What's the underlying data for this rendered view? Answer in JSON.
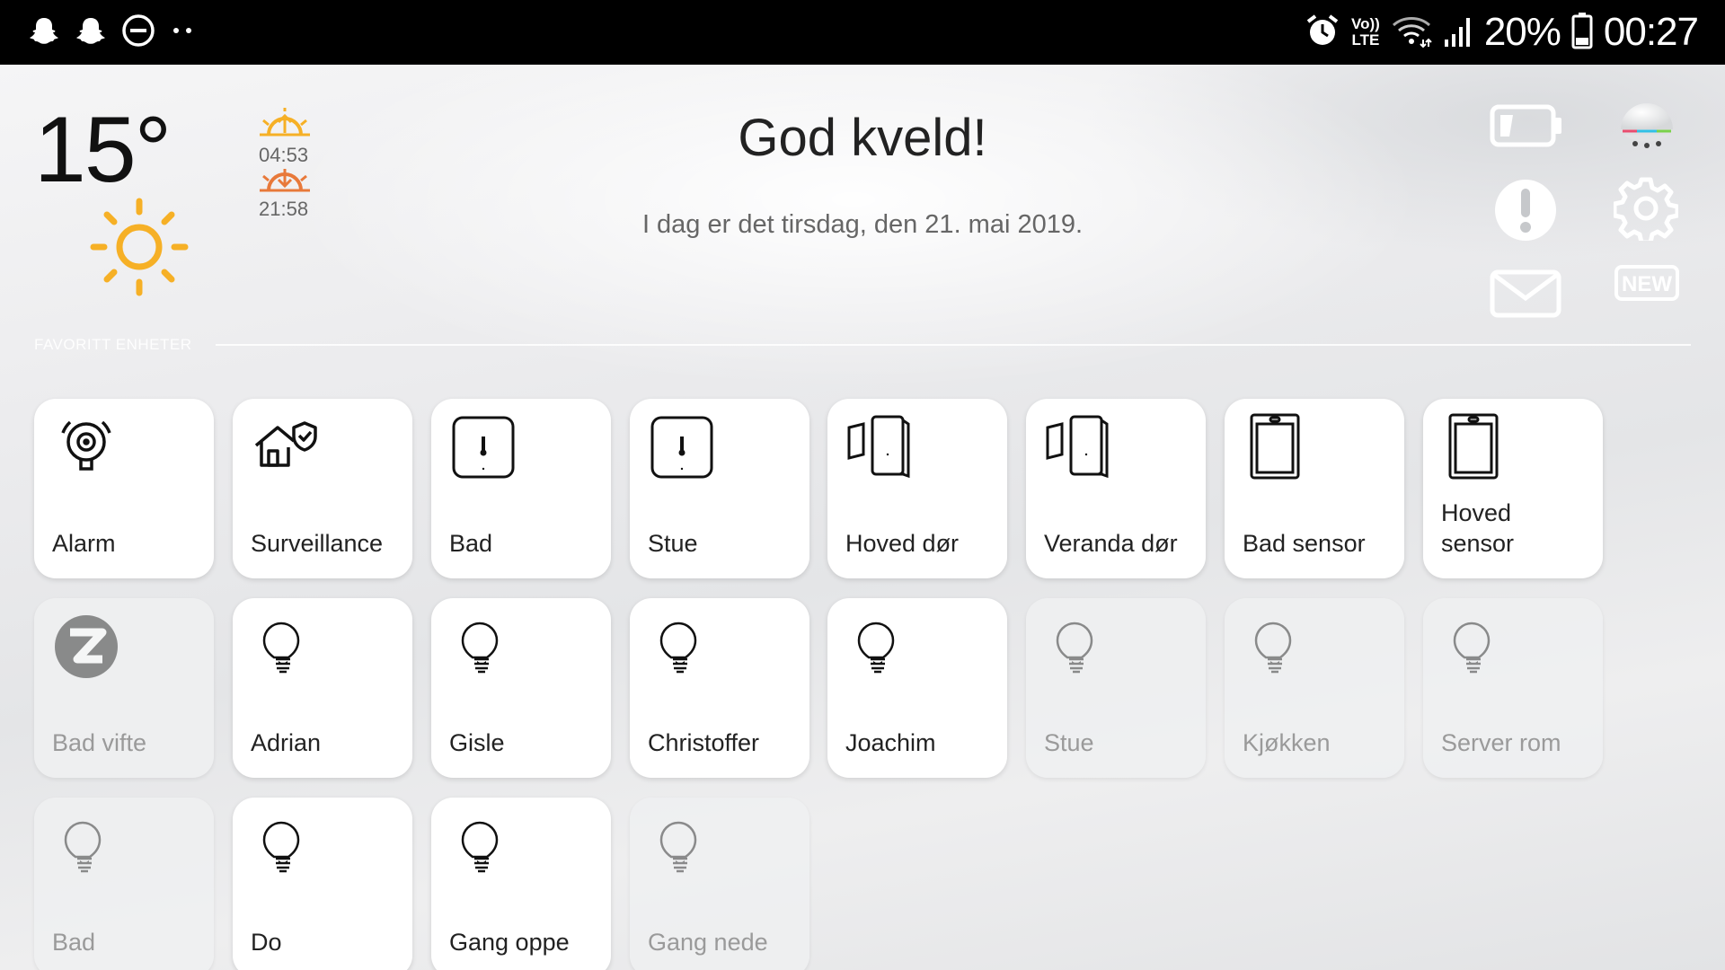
{
  "status_bar": {
    "left_icons": [
      "snapchat-icon",
      "snapchat-icon",
      "do-not-disturb-icon",
      "more-dots-icon"
    ],
    "volte_top": "Vo))",
    "volte_bottom": "LTE",
    "battery_percent": "20%",
    "time": "00:27"
  },
  "weather": {
    "temperature": "15°",
    "sunrise": "04:53",
    "sunset": "21:58"
  },
  "header": {
    "greeting": "God kveld!",
    "date_text": "I dag er det tirsdag, den 21. mai 2019."
  },
  "top_actions": {
    "new_badge": "NEW"
  },
  "section": {
    "label": "FAVORITT ENHETER"
  },
  "tiles_row1": [
    {
      "label": "Alarm",
      "icon": "alarm-bell-icon",
      "on": true
    },
    {
      "label": "Surveillance",
      "icon": "house-shield-icon",
      "on": true
    },
    {
      "label": "Bad",
      "icon": "thermometer-sensor-icon",
      "on": true
    },
    {
      "label": "Stue",
      "icon": "thermometer-sensor-icon",
      "on": true
    },
    {
      "label": "Hoved dør",
      "icon": "door-sensor-icon",
      "on": true
    },
    {
      "label": "Veranda dør",
      "icon": "door-sensor-icon",
      "on": true
    },
    {
      "label": "Bad sensor",
      "icon": "motion-sensor-icon",
      "on": true
    },
    {
      "label": "Hoved sensor",
      "icon": "motion-sensor-icon",
      "on": true
    }
  ],
  "tiles_row2": [
    {
      "label": "Bad vifte",
      "icon": "zwave-icon",
      "on": false
    },
    {
      "label": "Adrian",
      "icon": "light-bulb-icon",
      "on": true
    },
    {
      "label": "Gisle",
      "icon": "light-bulb-icon",
      "on": true
    },
    {
      "label": "Christoffer",
      "icon": "light-bulb-icon",
      "on": true
    },
    {
      "label": "Joachim",
      "icon": "light-bulb-icon",
      "on": true
    },
    {
      "label": "Stue",
      "icon": "light-bulb-icon",
      "on": false
    },
    {
      "label": "Kjøkken",
      "icon": "light-bulb-icon",
      "on": false
    },
    {
      "label": "Server rom",
      "icon": "light-bulb-icon",
      "on": false
    }
  ],
  "tiles_row3": [
    {
      "label": "Bad",
      "icon": "light-bulb-icon",
      "on": false
    },
    {
      "label": "Do",
      "icon": "light-bulb-icon",
      "on": true
    },
    {
      "label": "Gang oppe",
      "icon": "light-bulb-icon",
      "on": true
    },
    {
      "label": "Gang nede",
      "icon": "light-bulb-icon",
      "on": false
    }
  ],
  "colors": {
    "sun": "#f6b026",
    "sunset": "#e8793a",
    "tile_on": "#ffffff",
    "tile_off": "#eeeff1"
  }
}
